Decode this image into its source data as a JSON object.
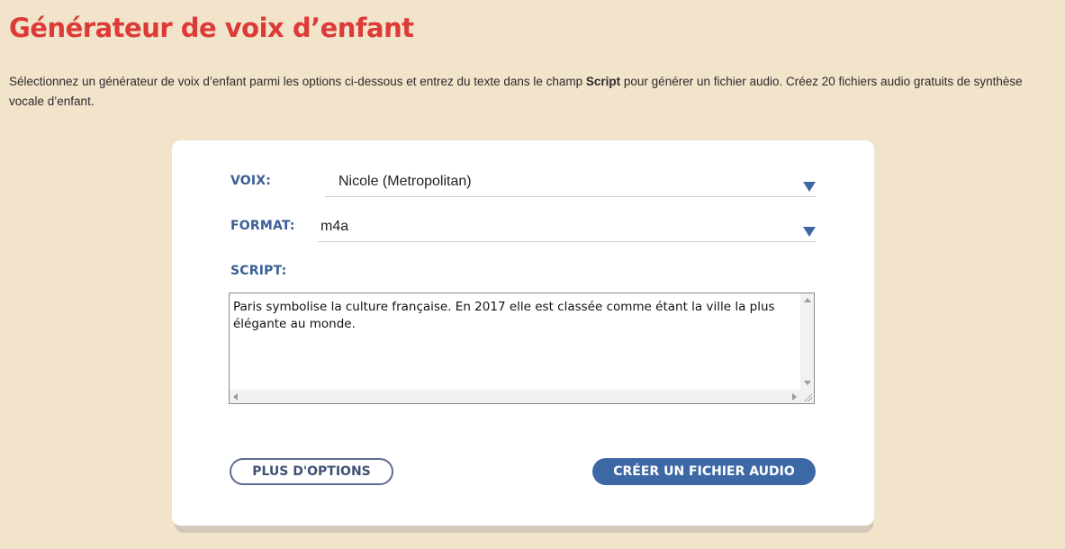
{
  "page": {
    "title": "Générateur de voix d’enfant",
    "intro_before": "Sélectionnez un générateur de voix d’enfant parmi les options ci-dessous et entrez du texte dans le champ ",
    "intro_bold": "Script",
    "intro_after": " pour générer un fichier audio. Créez 20 fichiers audio gratuits de synthèse vocale d’enfant."
  },
  "form": {
    "voice_label": "VOIX:",
    "voice_value": "Nicole (Metropolitan)",
    "format_label": "FORMAT:",
    "format_value": "m4a",
    "script_label": "SCRIPT:",
    "script_text": "Paris symbolise la culture française. En 2017 elle est classée comme étant la ville la plus élégante au monde.",
    "more_options_label": "PLUS D'OPTIONS",
    "create_label": "CRÉER UN FICHIER AUDIO"
  },
  "colors": {
    "background": "#f2e3cb",
    "title": "#dc3b37",
    "accent": "#3d68a6"
  },
  "icons": {
    "voice_dropdown": "chevron-down-icon",
    "format_dropdown": "chevron-down-icon"
  }
}
